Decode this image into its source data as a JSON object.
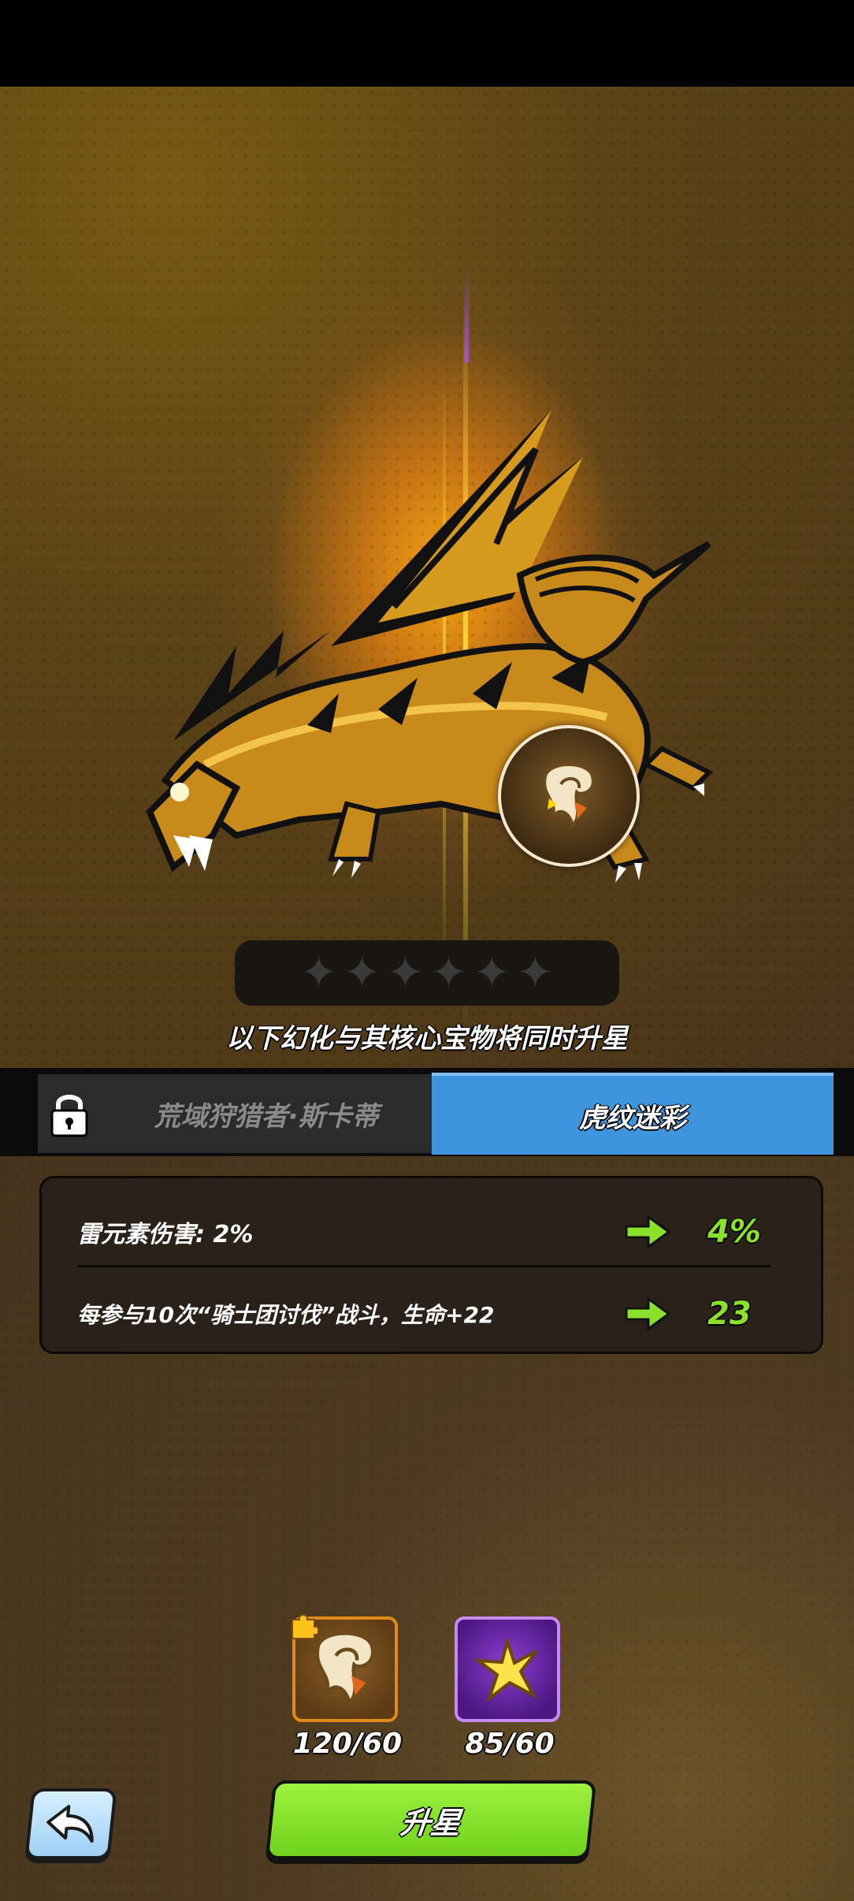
{
  "hero": {
    "star_count_filled": 0,
    "star_count_total": 6,
    "notice": "以下幻化与其核心宝物将同时升星"
  },
  "tabs": {
    "locked_label": "荒域狩猎者·斯卡蒂",
    "active_label": "虎纹迷彩"
  },
  "stats": [
    {
      "name": "雷元素伤害: 2%",
      "next": "4%"
    },
    {
      "name": "每参与10次“骑士团讨伐”战斗，生命+22",
      "next": "23"
    }
  ],
  "materials": [
    {
      "count": "120/60",
      "icon": "core-treasure-icon"
    },
    {
      "count": "85/60",
      "icon": "star-shard-icon"
    }
  ],
  "buttons": {
    "upgrade_label": "升星",
    "back_icon": "back-arrow-icon"
  },
  "colors": {
    "active_tab": "#3f95dd",
    "upgrade_button": "#8ae02a",
    "stat_value": "#8ae02a"
  }
}
